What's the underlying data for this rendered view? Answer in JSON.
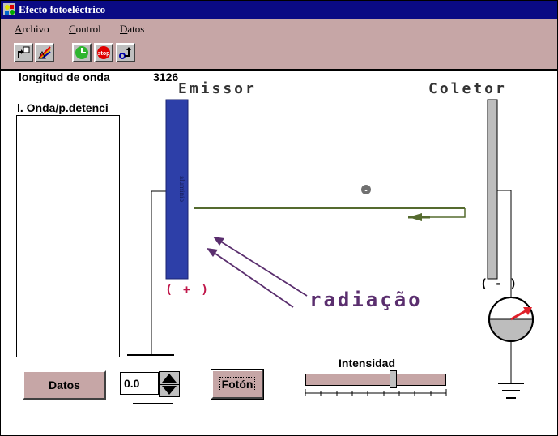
{
  "window": {
    "title": "Efecto fotoeléctrico"
  },
  "menu": [
    {
      "underline": "A",
      "rest": "rchivo"
    },
    {
      "underline": "C",
      "rest": "ontrol"
    },
    {
      "underline": "D",
      "rest": "atos"
    }
  ],
  "toolbar": {
    "icons": [
      "export-icon",
      "prism-icon",
      "clock-icon",
      "stop-icon",
      "graph-icon"
    ],
    "stop_label": "stop"
  },
  "readout": {
    "wavelength_label": "longitud de onda",
    "wavelength_value": "3126"
  },
  "scene": {
    "emitter_title": "Emissor",
    "collector_title": "Coletor",
    "emitter_material": "aluminio",
    "emitter_sign": "( + )",
    "collector_sign": "( - )",
    "radiation_label": "radiação",
    "electron_symbol": "-"
  },
  "list": {
    "label": "l. Onda/p.detenci",
    "items": []
  },
  "controls": {
    "datos_label": "Datos",
    "voltage_value": "0.0",
    "foton_label": "Fotón",
    "intensity_label": "Intensidad",
    "intensity_fraction": 0.63
  },
  "colors": {
    "titlebar": "#0a0a84",
    "chrome": "#c6a6a6",
    "emitter": "#2d3fa8",
    "beam": "#556b2f",
    "radiation": "#5a2e6e",
    "plus": "#c0174a"
  }
}
